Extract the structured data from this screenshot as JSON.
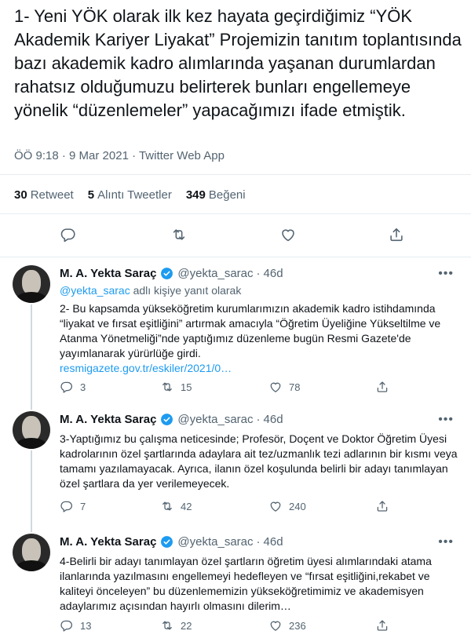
{
  "main_tweet": {
    "text": "1- Yeni YÖK olarak ilk kez hayata geçirdiğimiz “YÖK Akademik Kariyer Liyakat” Projemizin tanıtım toplantısında bazı akademik kadro alımlarında yaşanan durumlardan rahatsız olduğumuzu belirterek bunları engellemeye yönelik “düzenlemeler” yapacağımızı ifade etmiştik.",
    "meta": "ÖÖ 9:18 · 9 Mar 2021 · Twitter Web App",
    "retweets_count": "30",
    "retweets_label": "Retweet",
    "quotes_count": "5",
    "quotes_label": "Alıntı Tweetler",
    "likes_count": "349",
    "likes_label": "Beğeni"
  },
  "icons": {
    "reply": "reply-icon",
    "retweet": "retweet-icon",
    "like": "heart-icon",
    "share": "share-icon",
    "verified": "verified-badge-icon",
    "more": "more-icon"
  },
  "colors": {
    "link": "#1d9bf0",
    "muted": "#536471",
    "verified": "#1d9bf0"
  },
  "replies": [
    {
      "name": "M. A. Yekta Saraç",
      "handle": "@yekta_sarac",
      "separator": "·",
      "time": "46d",
      "reply_to_handle": "@yekta_sarac",
      "reply_to_suffix": " adlı kişiye yanıt olarak",
      "text": "2- Bu kapsamda yükseköğretim kurumlarımızın akademik kadro istihdamında “liyakat ve fırsat eşitliğini” artırmak amacıyla “Öğretim Üyeliğine Yükseltilme ve Atanma Yönetmeliği”nde yaptığımız düzenleme bugün Resmi Gazete'de yayımlanarak yürürlüğe girdi.",
      "link": "resmigazete.gov.tr/eskiler/2021/0…",
      "replies": "3",
      "retweets": "15",
      "likes": "78"
    },
    {
      "name": "M. A. Yekta Saraç",
      "handle": "@yekta_sarac",
      "separator": "·",
      "time": "46d",
      "text": "3-Yaptığımız bu çalışma neticesinde; Profesör, Doçent ve Doktor Öğretim Üyesi kadrolarının özel şartlarında adaylara ait tez/uzmanlık tezi adlarının bir kısmı veya tamamı yazılamayacak. Ayrıca, ilanın özel koşulunda belirli bir adayı tanımlayan özel şartlara da yer verilemeyecek.",
      "replies": "7",
      "retweets": "42",
      "likes": "240"
    },
    {
      "name": "M. A. Yekta Saraç",
      "handle": "@yekta_sarac",
      "separator": "·",
      "time": "46d",
      "text": "4-Belirli bir adayı tanımlayan özel şartların öğretim üyesi alımlarındaki atama ilanlarında yazılmasını engellemeyi hedefleyen ve “fırsat eşitliğini,rekabet ve kaliteyi önceleyen” bu düzenlememizin yükseköğretimimiz ve akademisyen adaylarımız açısından hayırlı olmasını dilerim…",
      "replies": "13",
      "retweets": "22",
      "likes": "236"
    }
  ]
}
